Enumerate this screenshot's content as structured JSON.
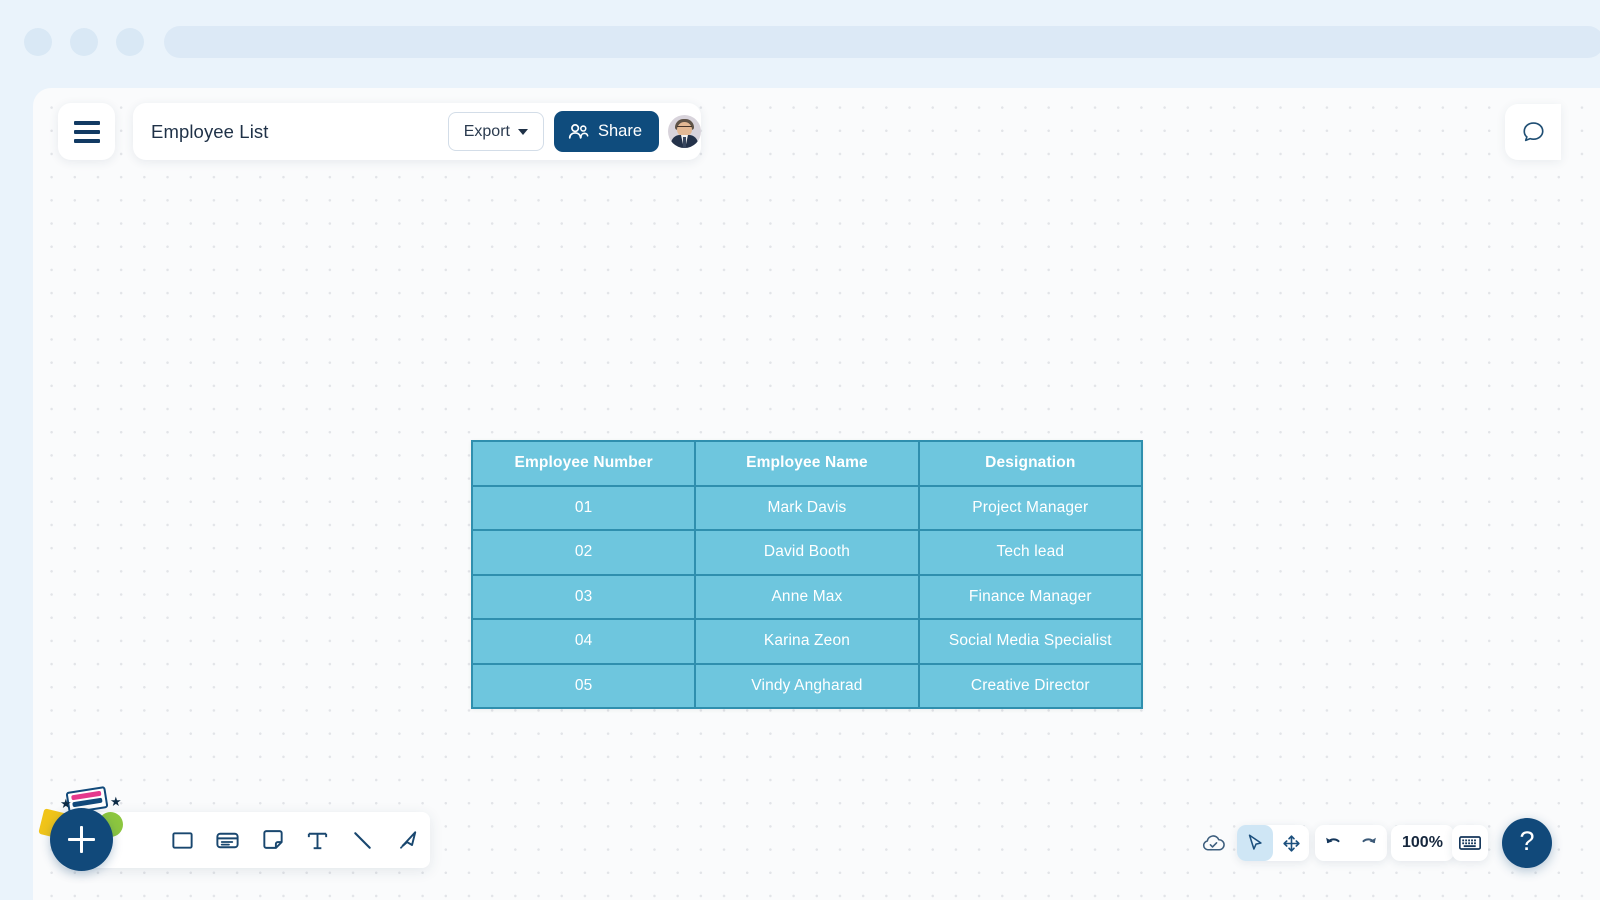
{
  "browser": {
    "dots": [
      "window-dot-1",
      "window-dot-2",
      "window-dot-3"
    ],
    "addressbar_value": ""
  },
  "header": {
    "menu_icon": "hamburger-icon",
    "title": "Employee List",
    "export_label": "Export",
    "export_caret_icon": "chevron-down-icon",
    "share_label": "Share",
    "share_icon": "people-icon",
    "avatar_alt": "user-avatar",
    "accent_navy": "#0f4c7d"
  },
  "right_rail": {
    "comment_icon": "comment-bubble-icon"
  },
  "table": {
    "columns": [
      "Employee Number",
      "Employee Name",
      "Designation"
    ],
    "rows": [
      [
        "01",
        "Mark Davis",
        "Project Manager"
      ],
      [
        "02",
        "David Booth",
        "Tech lead"
      ],
      [
        "03",
        "Anne Max",
        "Finance Manager"
      ],
      [
        "04",
        "Karina Zeon",
        "Social Media Specialist"
      ],
      [
        "05",
        "Vindy Angharad",
        "Creative Director"
      ]
    ],
    "cell_fill": "#6ec6de",
    "cell_border": "#2f8fae",
    "text_color": "#ffffff"
  },
  "toolbar": {
    "add_label": "+",
    "tools": [
      {
        "name": "shape-rectangle-icon",
        "label": "Shape"
      },
      {
        "name": "card-icon",
        "label": "Card"
      },
      {
        "name": "sticky-note-icon",
        "label": "Sticky note"
      },
      {
        "name": "text-icon",
        "label": "Text"
      },
      {
        "name": "line-icon",
        "label": "Line"
      },
      {
        "name": "pen-icon",
        "label": "Pen"
      }
    ]
  },
  "statusbar": {
    "cloud_icon": "cloud-saved-icon",
    "pointer_icon": "cursor-arrow-icon",
    "pan_icon": "move-arrows-icon",
    "undo_icon": "undo-arrow-icon",
    "redo_icon": "redo-arrow-icon",
    "zoom_level": "100%",
    "shortcuts_icon": "keyboard-icon",
    "help_label": "?"
  }
}
